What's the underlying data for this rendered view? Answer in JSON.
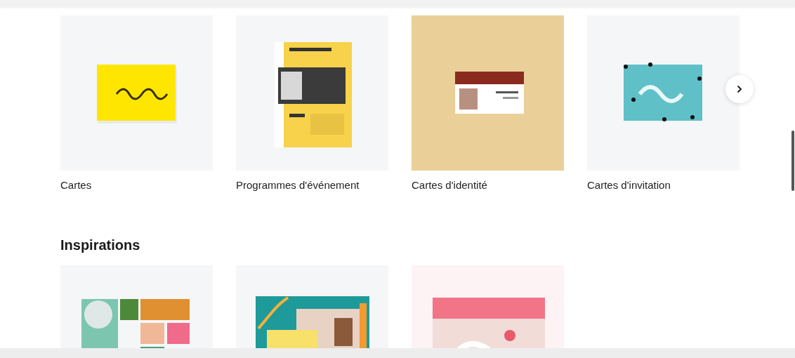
{
  "categories": [
    {
      "label": "Cartes",
      "kind": "picture"
    },
    {
      "label": "Programmes d'événement",
      "kind": "picture"
    },
    {
      "label": "Cartes d'identité",
      "kind": "picture"
    },
    {
      "label": "Cartes d'invitation",
      "kind": "picture"
    }
  ],
  "inspirations": {
    "title": "Inspirations"
  }
}
